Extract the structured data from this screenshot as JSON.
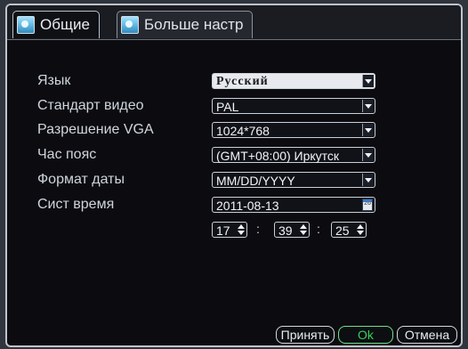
{
  "tabs": [
    {
      "label": "Общие",
      "active": true
    },
    {
      "label": "Больше настр",
      "active": false
    }
  ],
  "settings": {
    "language": {
      "label": "Язык",
      "value": "Русский"
    },
    "video_standard": {
      "label": "Стандарт видео",
      "value": "PAL"
    },
    "vga_resolution": {
      "label": "Разрешение VGA",
      "value": "1024*768"
    },
    "time_zone": {
      "label": "Час пояс",
      "value": "(GMT+08:00) Иркутск"
    },
    "date_format": {
      "label": "Формат даты",
      "value": "MM/DD/YYYY"
    },
    "system_time": {
      "label": "Сист время",
      "date": "2011-08-13",
      "calendar_day": "26"
    }
  },
  "time": {
    "hour": "17",
    "minute": "39",
    "second": "25",
    "separator": ":"
  },
  "buttons": {
    "apply": "Принять",
    "ok": "Ok",
    "cancel": "Отмена"
  },
  "colors": {
    "ok_text": "#34d15b"
  }
}
